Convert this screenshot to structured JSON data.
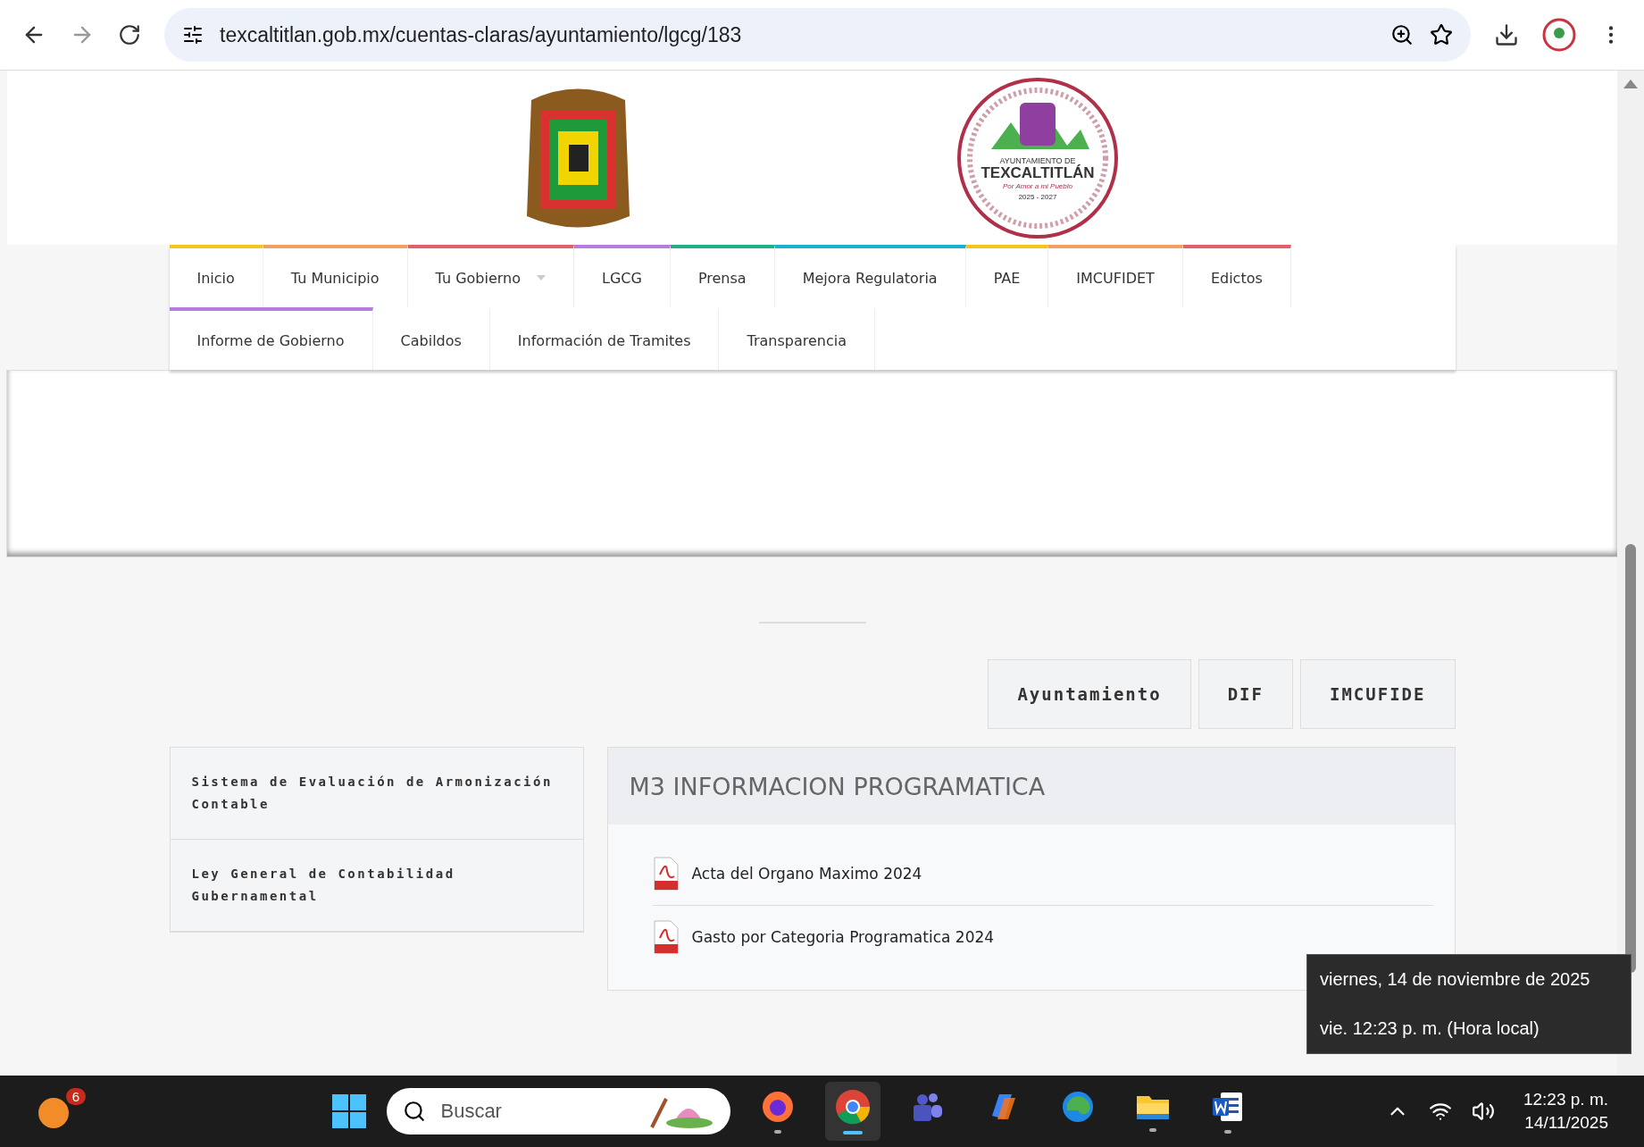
{
  "browser": {
    "url": "texcaltitlan.gob.mx/cuentas-claras/ayuntamiento/lgcg/183"
  },
  "logo_right": {
    "top": "AYUNTAMIENTO DE",
    "name": "TEXCALTITLÁN",
    "motto": "Por Amor a mi Pueblo",
    "years": "2025 - 2027"
  },
  "nav_rows": [
    {
      "items": [
        {
          "label": "Inicio",
          "color": "#f5c518",
          "dropdown": false
        },
        {
          "label": "Tu Municipio",
          "color": "#f0a060",
          "dropdown": false
        },
        {
          "label": "Tu Gobierno",
          "color": "#e85d6a",
          "dropdown": true
        },
        {
          "label": "LGCG",
          "color": "#b57ce0",
          "dropdown": false
        },
        {
          "label": "Prensa",
          "color": "#1fb08a",
          "dropdown": false
        },
        {
          "label": "Mejora Regulatoria",
          "color": "#1ab0d0",
          "dropdown": false
        },
        {
          "label": "PAE",
          "color": "#f5c518",
          "dropdown": false
        },
        {
          "label": "IMCUFIDET",
          "color": "#f0a060",
          "dropdown": false
        },
        {
          "label": "Edictos",
          "color": "#e85d6a",
          "dropdown": false
        }
      ]
    },
    {
      "items": [
        {
          "label": "Informe de Gobierno",
          "color": "#b57ce0",
          "dropdown": false
        },
        {
          "label": "Cabildos",
          "dropdown": false
        },
        {
          "label": "Información de Tramites",
          "dropdown": false
        },
        {
          "label": "Transparencia",
          "dropdown": false
        }
      ]
    }
  ],
  "entity_buttons": [
    "Ayuntamiento",
    "DIF",
    "IMCUFIDE"
  ],
  "side_menu": [
    "Sistema de Evaluación de Armonización Contable",
    "Ley General de Contabilidad Gubernamental"
  ],
  "panel": {
    "title": "M3 INFORMACION PROGRAMATICA",
    "documents": [
      "Acta del Organo Maximo 2024",
      "Gasto por Categoria Programatica 2024"
    ]
  },
  "tooltip": {
    "date": "viernes, 14 de noviembre de 2025",
    "time": "vie. 12:23 p. m. (Hora local)"
  },
  "taskbar": {
    "badge": "6",
    "search_placeholder": "Buscar",
    "apps": [
      {
        "kind": "firefox",
        "selected": false,
        "running": true
      },
      {
        "kind": "chrome",
        "selected": true,
        "running": true
      },
      {
        "kind": "teams",
        "selected": false,
        "running": false
      },
      {
        "kind": "copilot",
        "selected": false,
        "running": false
      },
      {
        "kind": "edge",
        "selected": false,
        "running": false
      },
      {
        "kind": "explorer",
        "selected": false,
        "running": true
      },
      {
        "kind": "word",
        "selected": false,
        "running": true
      }
    ],
    "time": "12:23 p. m.",
    "date": "14/11/2025"
  }
}
